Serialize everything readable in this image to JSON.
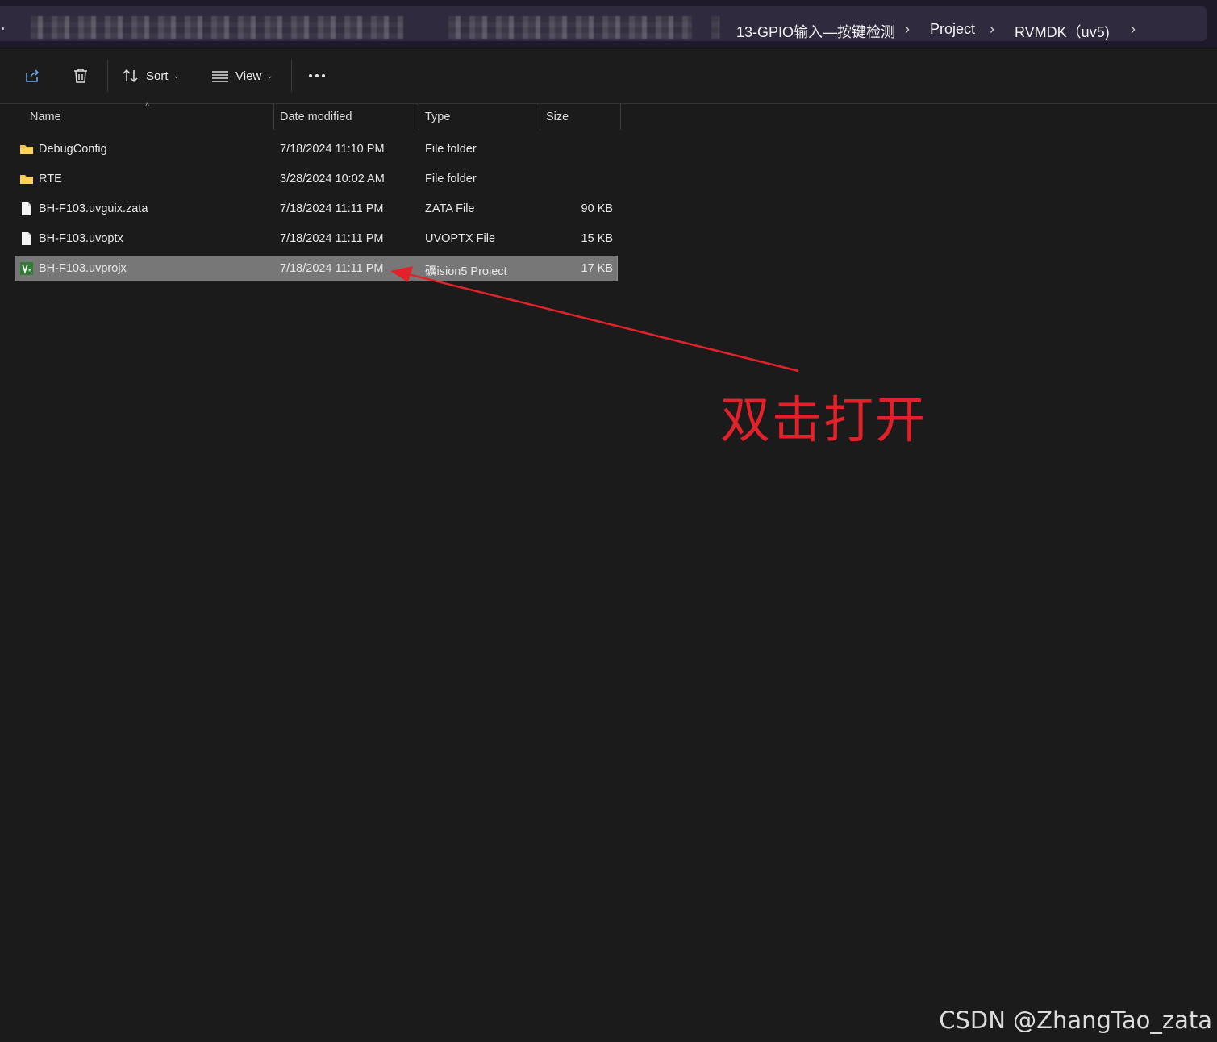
{
  "breadcrumb": {
    "items": [
      "13-GPIO输入—按键检测",
      "Project",
      "RVMDK（uv5)"
    ]
  },
  "toolbar": {
    "sort_label": "Sort",
    "view_label": "View"
  },
  "columns": {
    "name": "Name",
    "date": "Date modified",
    "type": "Type",
    "size": "Size"
  },
  "files": [
    {
      "name": "DebugConfig",
      "date": "7/18/2024 11:10 PM",
      "type": "File folder",
      "size": "",
      "icon": "folder-icon"
    },
    {
      "name": "RTE",
      "date": "3/28/2024 10:02 AM",
      "type": "File folder",
      "size": "",
      "icon": "folder-icon"
    },
    {
      "name": "BH-F103.uvguix.zata",
      "date": "7/18/2024 11:11 PM",
      "type": "ZATA File",
      "size": "90 KB",
      "icon": "file-icon"
    },
    {
      "name": "BH-F103.uvoptx",
      "date": "7/18/2024 11:11 PM",
      "type": "UVOPTX File",
      "size": "15 KB",
      "icon": "file-icon"
    },
    {
      "name": "BH-F103.uvprojx",
      "date": "7/18/2024 11:11 PM",
      "type": "礦ision5 Project",
      "size": "17 KB",
      "icon": "keil-project-icon",
      "selected": true
    }
  ],
  "annotation": {
    "text": "双击打开",
    "color": "#e3212a"
  },
  "watermark": "CSDN @ZhangTao_zata"
}
